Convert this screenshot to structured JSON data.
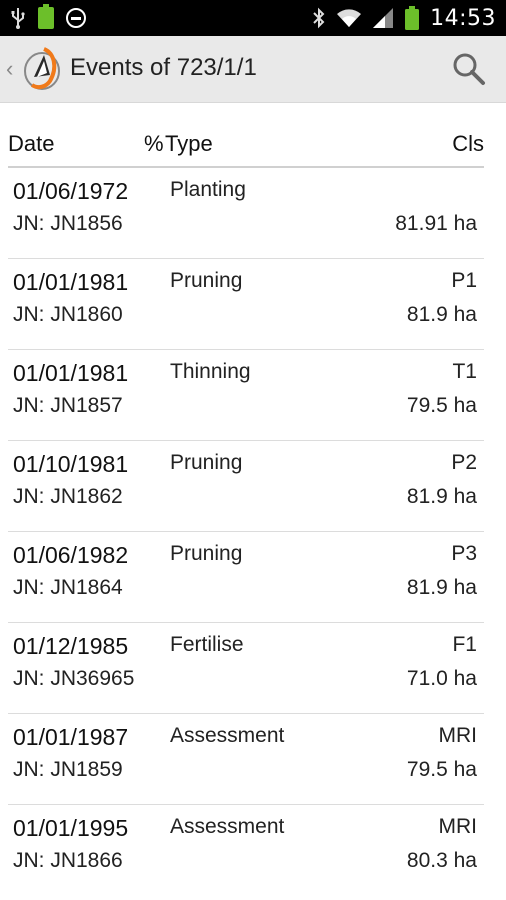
{
  "status_bar": {
    "time": "14:53",
    "icons": [
      "usb-icon",
      "battery-small-icon",
      "do-not-disturb-icon",
      "bluetooth-icon",
      "wifi-icon",
      "signal-icon",
      "battery-icon"
    ]
  },
  "action_bar": {
    "title": "Events of 723/1/1",
    "up_caret": "‹"
  },
  "header": {
    "date": "Date",
    "pct": "%",
    "type": "Type",
    "cls": "Cls"
  },
  "events": [
    {
      "date": "01/06/1972",
      "type": "Planting",
      "cls": "",
      "jn": "JN: JN1856",
      "area": "81.91 ha"
    },
    {
      "date": "01/01/1981",
      "type": "Pruning",
      "cls": "P1",
      "jn": "JN: JN1860",
      "area": "81.9 ha"
    },
    {
      "date": "01/01/1981",
      "type": "Thinning",
      "cls": "T1",
      "jn": "JN: JN1857",
      "area": "79.5 ha"
    },
    {
      "date": "01/10/1981",
      "type": "Pruning",
      "cls": "P2",
      "jn": "JN: JN1862",
      "area": "81.9 ha"
    },
    {
      "date": "01/06/1982",
      "type": "Pruning",
      "cls": "P3",
      "jn": "JN: JN1864",
      "area": "81.9 ha"
    },
    {
      "date": "01/12/1985",
      "type": "Fertilise",
      "cls": "F1",
      "jn": "JN: JN36965",
      "area": "71.0 ha"
    },
    {
      "date": "01/01/1987",
      "type": "Assessment",
      "cls": "MRI",
      "jn": "JN: JN1859",
      "area": "79.5 ha"
    },
    {
      "date": "01/01/1995",
      "type": "Assessment",
      "cls": "MRI",
      "jn": "JN: JN1866",
      "area": "80.3 ha"
    }
  ]
}
